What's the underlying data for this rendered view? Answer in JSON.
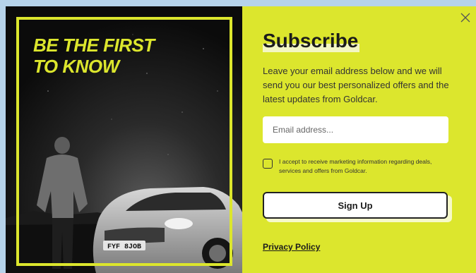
{
  "promo": {
    "headline_line1": "BE THE FIRST",
    "headline_line2": "TO KNOW",
    "plate_text": "FYF 8JOB",
    "accent_color": "#dce62d"
  },
  "form": {
    "title": "Subscribe",
    "description": "Leave your email address below and we will send you our best personalized offers and the latest updates from Goldcar.",
    "email_placeholder": "Email address...",
    "email_value": "",
    "consent_label": "I accept to receive marketing information regarding deals, services and offers from Goldcar.",
    "consent_checked": false,
    "signup_label": "Sign Up",
    "privacy_label": "Privacy Policy",
    "close_icon": "close-icon"
  }
}
